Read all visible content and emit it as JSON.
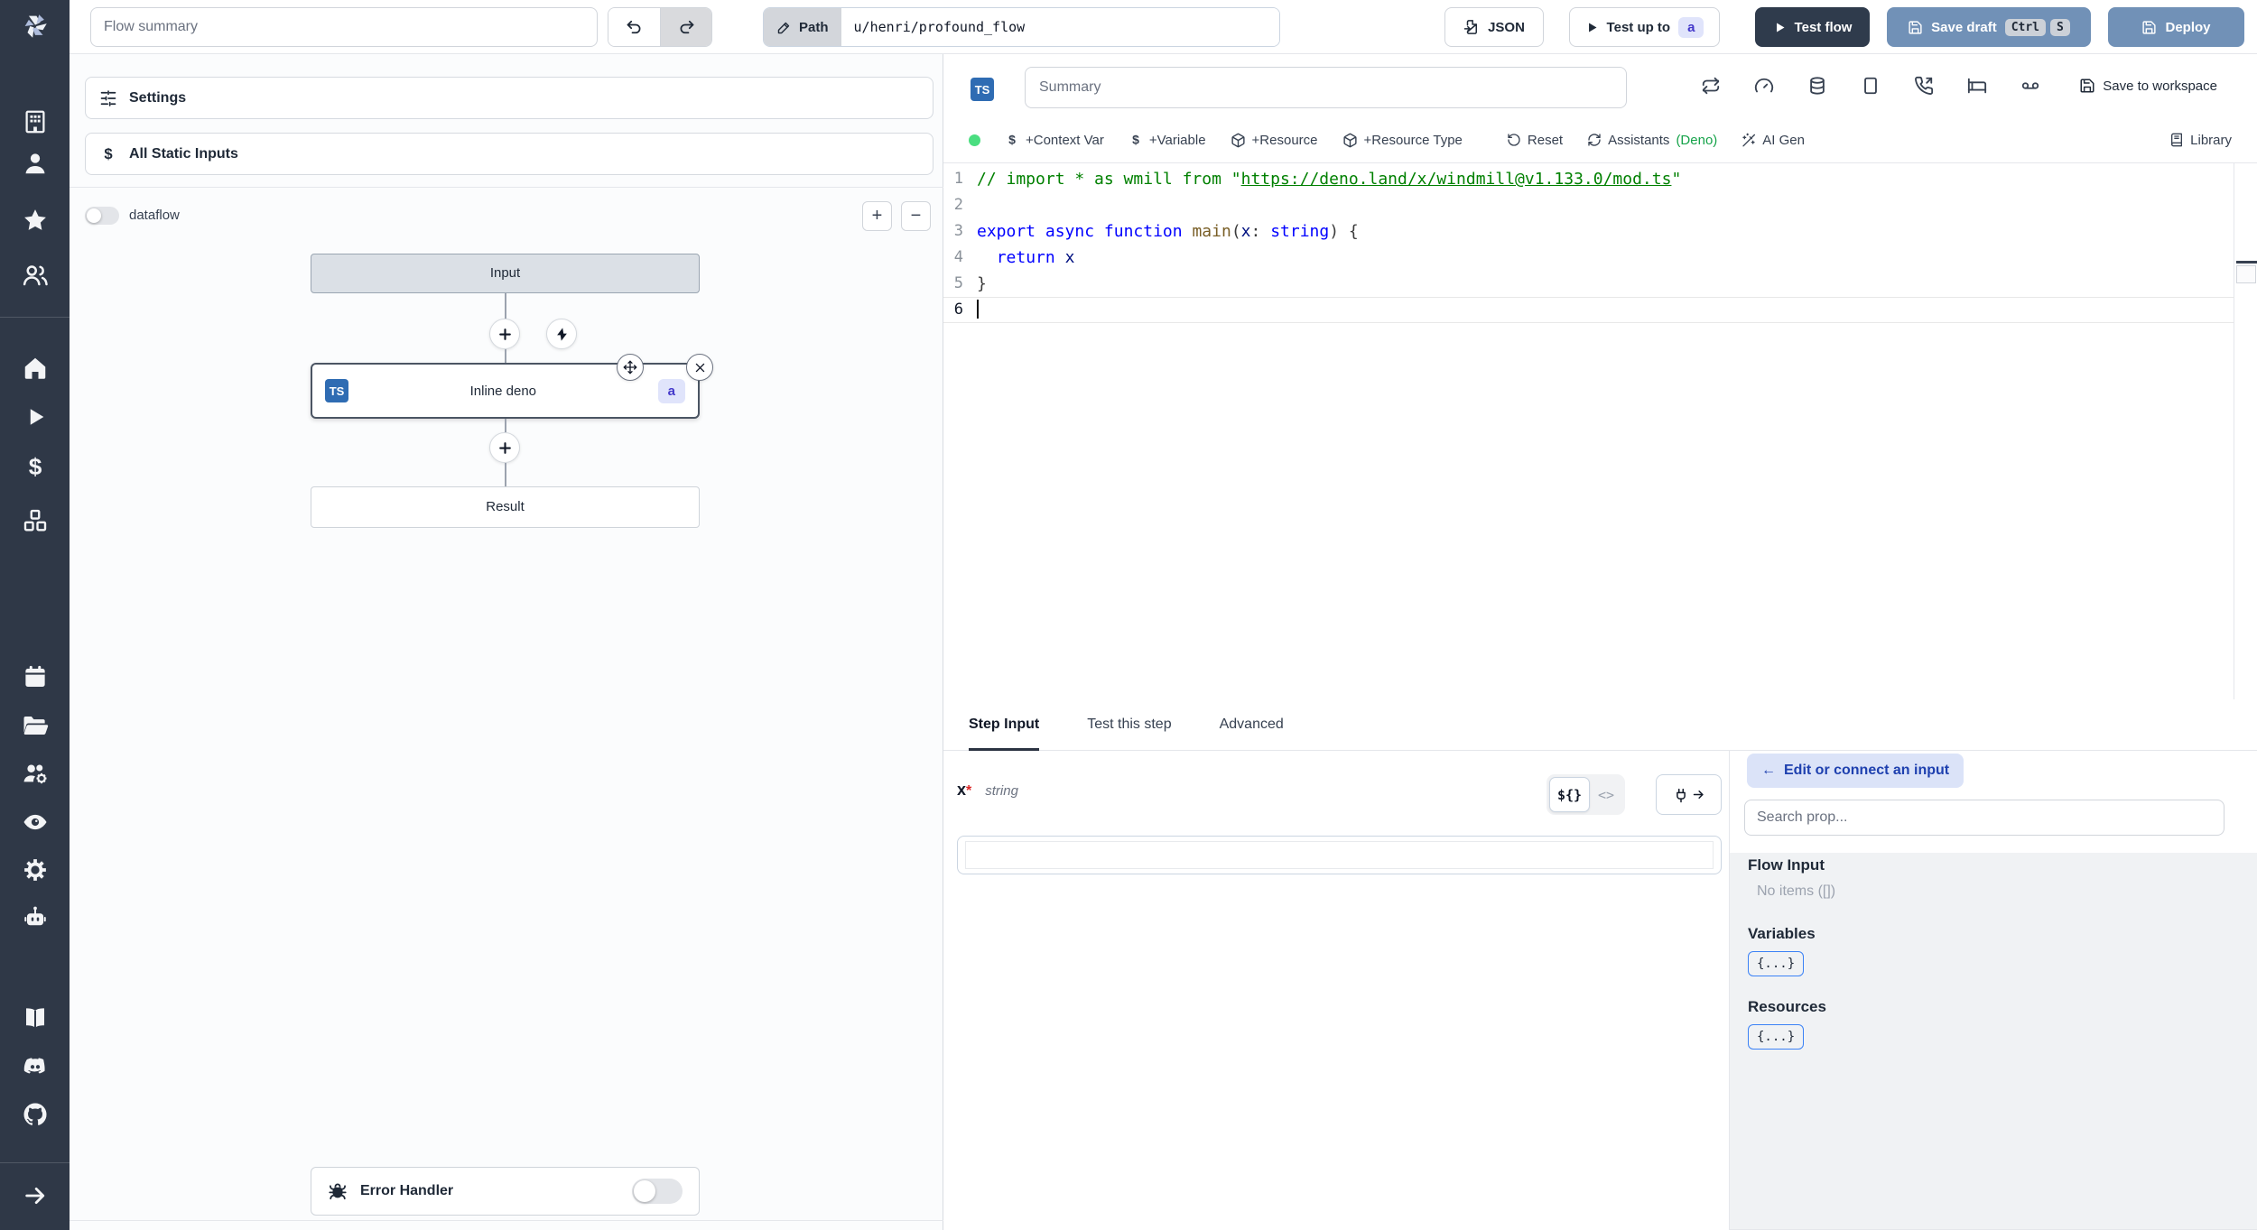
{
  "colors": {
    "sidebar_bg": "#2f3847",
    "steel_button": "#7191b7",
    "dark_button": "#2f3b4c",
    "id_badge_bg": "#e0e4fb",
    "id_badge_text": "#4338ca",
    "ts_badge_bg": "#2f6cb3",
    "status_dot_green": "#4ade80",
    "deno_green": "#16a34a",
    "code_comment_green": "#008000",
    "code_keyword_blue": "#0000ff",
    "edit_btn_bg": "#dbe3f8",
    "edit_btn_text": "#1e40af"
  },
  "topbar": {
    "flow_summary_placeholder": "Flow summary",
    "path_button": "Path",
    "path_value": "u/henri/profound_flow",
    "json_button": "JSON",
    "test_up_to_button": "Test up to",
    "test_up_to_badge": "a",
    "test_flow_button": "Test flow",
    "save_draft_button": "Save draft",
    "kbd_ctrl": "Ctrl",
    "kbd_s": "S",
    "deploy_button": "Deploy"
  },
  "sidebar": {
    "icons": [
      "windmill-logo",
      "building",
      "user",
      "star",
      "users",
      "home",
      "play",
      "dollar",
      "boxes",
      "calendar",
      "folder-open",
      "users-cog",
      "eye",
      "settings-gear",
      "bot",
      "book",
      "discord",
      "github",
      "expand-arrow"
    ]
  },
  "flow_panel": {
    "settings_button": "Settings",
    "static_inputs_button": "All Static Inputs",
    "dataflow_toggle_label": "dataflow",
    "zoom_in": "+",
    "zoom_out": "−",
    "input_node": "Input",
    "step_node": {
      "lang_badge": "TS",
      "label": "Inline deno",
      "id_badge": "a"
    },
    "result_node": "Result",
    "error_handler": "Error Handler"
  },
  "editor_panel": {
    "lang_badge": "TS",
    "summary_placeholder": "Summary",
    "save_to_workspace": "Save to workspace",
    "toolbar_icons": [
      "repeat-icon",
      "gauge-icon",
      "database-icon",
      "square-icon",
      "phone-incoming-icon",
      "bed-icon",
      "voicemail-icon",
      "save-icon"
    ],
    "actions": {
      "context_var": "+Context Var",
      "variable": "+Variable",
      "resource": "+Resource",
      "resource_type": "+Resource Type",
      "reset": "Reset",
      "assistants": "Assistants",
      "assistants_lang": "(Deno)",
      "ai_gen": "AI Gen",
      "library": "Library"
    },
    "code": {
      "language": "typescript",
      "lines": [
        {
          "n": 1,
          "tokens": [
            {
              "c": "cmt",
              "t": "// import * as wmill from \""
            },
            {
              "c": "lnk",
              "t": "https://deno.land/x/windmill@v1.133.0/mod.ts"
            },
            {
              "c": "cmt",
              "t": "\""
            }
          ]
        },
        {
          "n": 2,
          "tokens": []
        },
        {
          "n": 3,
          "tokens": [
            {
              "c": "kw",
              "t": "export"
            },
            {
              "c": "pl",
              "t": " "
            },
            {
              "c": "kw",
              "t": "async"
            },
            {
              "c": "pl",
              "t": " "
            },
            {
              "c": "kw",
              "t": "function"
            },
            {
              "c": "pl",
              "t": " "
            },
            {
              "c": "fn",
              "t": "main"
            },
            {
              "c": "pl",
              "t": "("
            },
            {
              "c": "id",
              "t": "x"
            },
            {
              "c": "pl",
              "t": ": "
            },
            {
              "c": "kw",
              "t": "string"
            },
            {
              "c": "pl",
              "t": ") {"
            }
          ]
        },
        {
          "n": 4,
          "tokens": [
            {
              "c": "pl",
              "t": "  "
            },
            {
              "c": "kw",
              "t": "return"
            },
            {
              "c": "pl",
              "t": " "
            },
            {
              "c": "id",
              "t": "x"
            }
          ]
        },
        {
          "n": 5,
          "tokens": [
            {
              "c": "pl",
              "t": "}"
            }
          ]
        },
        {
          "n": 6,
          "tokens": [],
          "active": true,
          "cursor": true
        }
      ]
    }
  },
  "step_panel": {
    "tabs": [
      "Step Input",
      "Test this step",
      "Advanced"
    ],
    "active_tab": "Step Input",
    "field": {
      "name": "x",
      "required_mark": "*",
      "type": "string"
    },
    "expr_button": "${}",
    "code_button": "<>",
    "input_value": ""
  },
  "connect_panel": {
    "back_arrow": "←",
    "edit_button_label": "Edit or connect an input",
    "search_placeholder": "Search prop...",
    "flow_input_title": "Flow Input",
    "flow_input_empty": "No items ([])",
    "variables_title": "Variables",
    "variables_button": "{...}",
    "resources_title": "Resources",
    "resources_button": "{...}"
  }
}
